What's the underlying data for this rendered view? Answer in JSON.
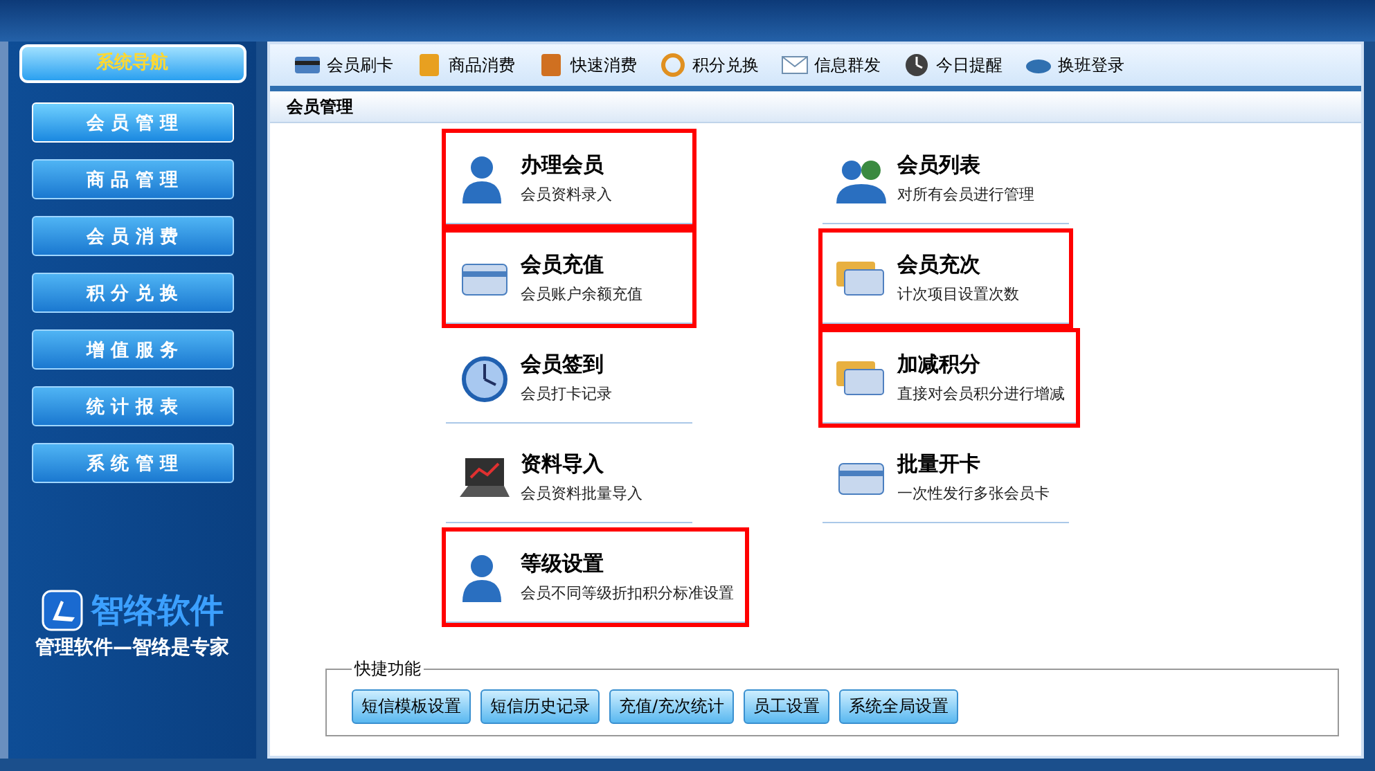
{
  "sidebar": {
    "title": "系统导航",
    "items": [
      {
        "label": "会 员 管 理",
        "selected": true
      },
      {
        "label": "商 品 管 理",
        "selected": false
      },
      {
        "label": "会 员 消 费",
        "selected": false
      },
      {
        "label": "积 分 兑 换",
        "selected": false
      },
      {
        "label": "增 值 服 务",
        "selected": false
      },
      {
        "label": "统 计 报 表",
        "selected": false
      },
      {
        "label": "系 统 管 理",
        "selected": false
      }
    ],
    "logo": {
      "name": "智络软件",
      "slogan": "管理软件—智络是专家"
    }
  },
  "toolbar": [
    {
      "label": "会员刷卡",
      "kind": "card"
    },
    {
      "label": "商品消费",
      "kind": "money"
    },
    {
      "label": "快速消费",
      "kind": "cash"
    },
    {
      "label": "积分兑换",
      "kind": "exchange"
    },
    {
      "label": "信息群发",
      "kind": "mail"
    },
    {
      "label": "今日提醒",
      "kind": "clock"
    },
    {
      "label": "换班登录",
      "kind": "login"
    }
  ],
  "panel": {
    "title": "会员管理",
    "items": [
      {
        "title": "办理会员",
        "subtitle": "会员资料录入",
        "kind": "person",
        "highlighted": true
      },
      {
        "title": "会员列表",
        "subtitle": "对所有会员进行管理",
        "kind": "people",
        "highlighted": false
      },
      {
        "title": "会员充值",
        "subtitle": "会员账户余额充值",
        "kind": "card",
        "highlighted": true
      },
      {
        "title": "会员充次",
        "subtitle": "计次项目设置次数",
        "kind": "cards",
        "highlighted": true
      },
      {
        "title": "会员签到",
        "subtitle": "会员打卡记录",
        "kind": "clock",
        "highlighted": false
      },
      {
        "title": "加减积分",
        "subtitle": "直接对会员积分进行增减",
        "kind": "cards",
        "highlighted": true
      },
      {
        "title": "资料导入",
        "subtitle": "会员资料批量导入",
        "kind": "laptop",
        "highlighted": false
      },
      {
        "title": "批量开卡",
        "subtitle": "一次性发行多张会员卡",
        "kind": "card",
        "highlighted": false
      },
      {
        "title": "等级设置",
        "subtitle": "会员不同等级折扣积分标准设置",
        "kind": "person",
        "highlighted": true
      }
    ]
  },
  "shortcuts": {
    "title": "快捷功能",
    "buttons": [
      "短信模板设置",
      "短信历史记录",
      "充值/充次统计",
      "员工设置",
      "系统全局设置"
    ]
  }
}
